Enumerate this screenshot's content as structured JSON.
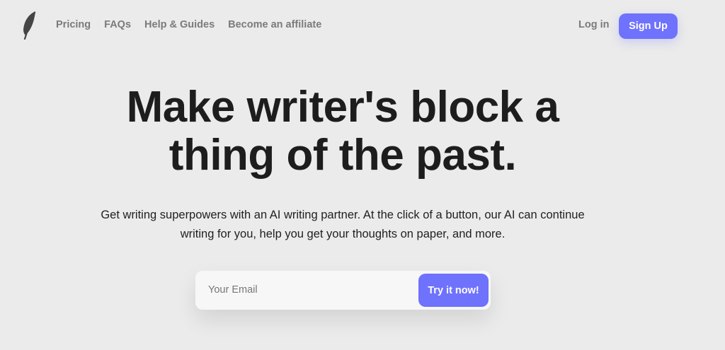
{
  "header": {
    "logo_icon": "feather-icon",
    "nav": [
      "Pricing",
      "FAQs",
      "Help & Guides",
      "Become an affiliate"
    ],
    "login_label": "Log in",
    "signup_label": "Sign Up"
  },
  "hero": {
    "title_line1": "Make writer's block a",
    "title_line2": "thing of the past.",
    "subtitle_line1": "Get writing superpowers with an AI writing partner. At the click of a button, our AI can continue",
    "subtitle_line2": "writing for you, help you get your thoughts on paper, and more."
  },
  "form": {
    "email_placeholder": "Your Email",
    "email_value": "",
    "submit_label": "Try it now!"
  },
  "colors": {
    "background": "#ebebeb",
    "accent": "#6e72fc",
    "nav_text": "#7b7b7b",
    "heading": "#1d1d1d"
  }
}
